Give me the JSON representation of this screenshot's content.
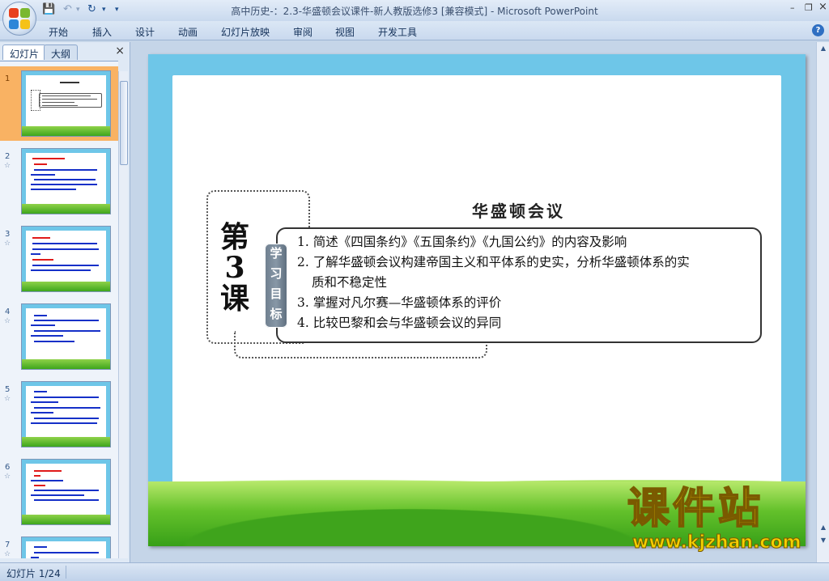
{
  "window": {
    "title": "高中历史-：2.3-华盛顿会议课件-新人教版选修3 [兼容模式] - Microsoft PowerPoint"
  },
  "window_controls": {
    "minimize": "–",
    "restore": "❐",
    "close": "×"
  },
  "ribbon": {
    "tabs": [
      "开始",
      "插入",
      "设计",
      "动画",
      "幻灯片放映",
      "审阅",
      "视图",
      "开发工具"
    ],
    "help_icon": "?"
  },
  "left_panel": {
    "tabs": {
      "slides": "幻灯片",
      "outline": "大纲"
    },
    "close": "×",
    "slides": [
      {
        "number": "1",
        "selected": true
      },
      {
        "number": "2",
        "has_animation": true
      },
      {
        "number": "3",
        "has_animation": true
      },
      {
        "number": "4",
        "has_animation": true
      },
      {
        "number": "5",
        "has_animation": true
      },
      {
        "number": "6",
        "has_animation": true
      },
      {
        "number": "7",
        "has_animation": true
      }
    ],
    "animation_icon": "☆"
  },
  "slide": {
    "lesson": [
      "第",
      "3",
      "课"
    ],
    "title": "华盛顿会议",
    "objectives_tag": [
      "学",
      "习",
      "目",
      "标"
    ],
    "objectives": [
      {
        "text": "1. 简述《四国条约》《五国条约》《九国公约》的内容及影响"
      },
      {
        "text": "2. 了解华盛顿会议构建帝国主义和平体系的史实，分析华盛顿体系的实"
      },
      {
        "text": "质和不稳定性",
        "continuation": true
      },
      {
        "text": "3. 掌握对凡尔赛—华盛顿体系的评价"
      },
      {
        "text": "4.  比较巴黎和会与华盛顿会议的异同"
      }
    ]
  },
  "watermark": {
    "brand": "课件站",
    "url": "www.kjzhan.com"
  },
  "status_bar": {
    "slide_indicator": "幻灯片 1/24"
  },
  "colors": {
    "slide_frame": "#6ec6e8",
    "grass": "#5cbc2a",
    "thumb_selected": "#f9b263",
    "watermark": "#f4d000"
  }
}
